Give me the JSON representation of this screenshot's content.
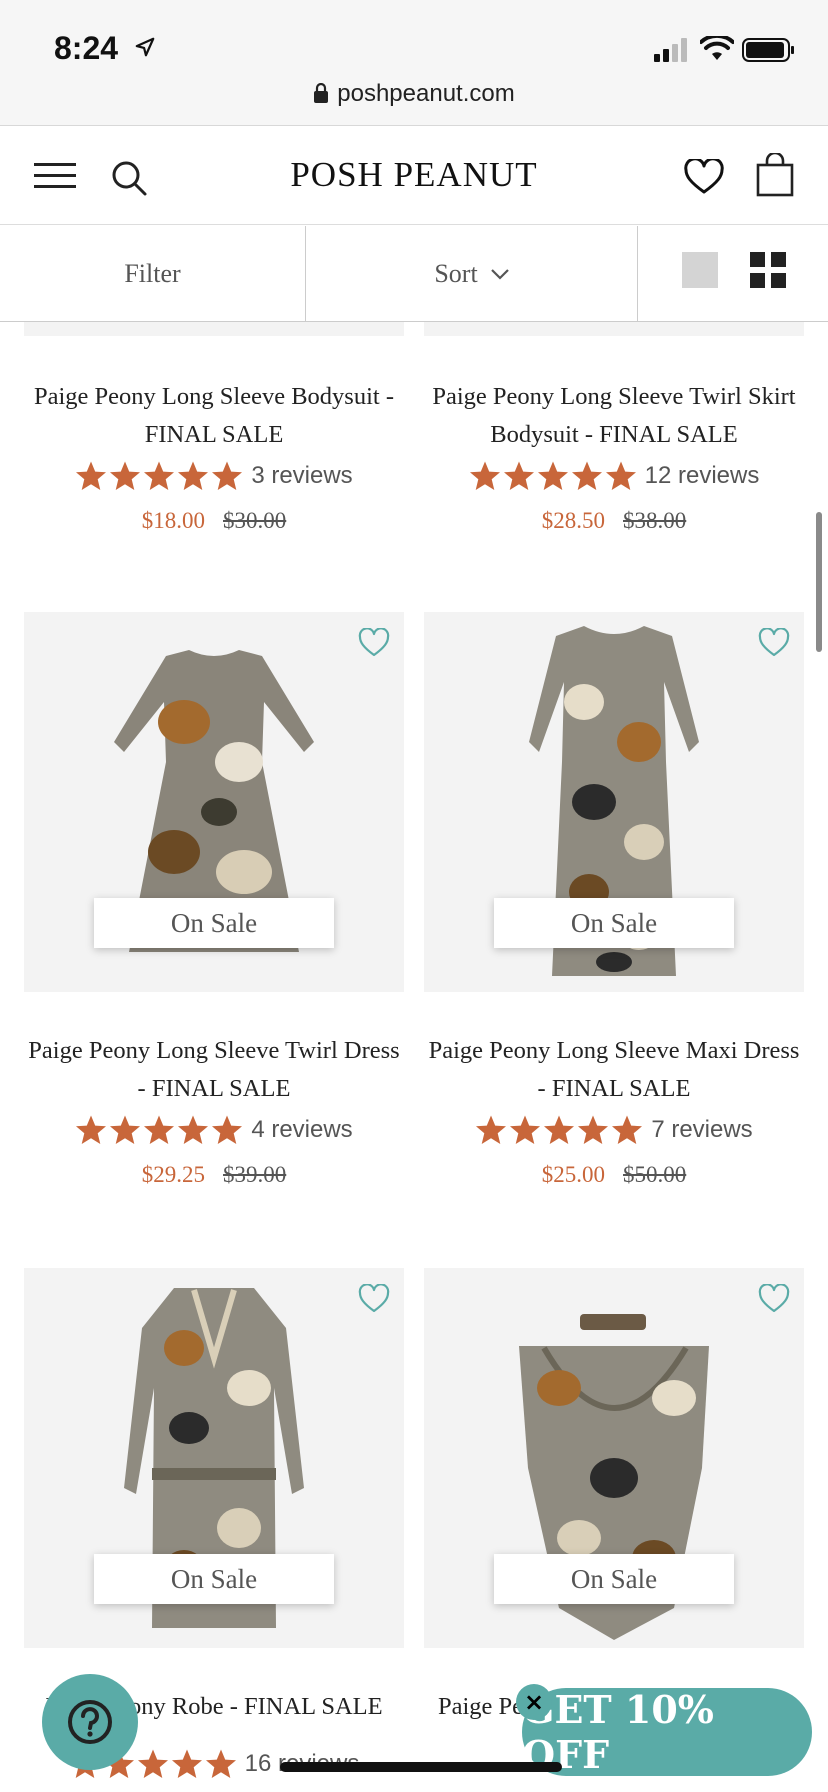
{
  "status_bar": {
    "time": "8:24",
    "url": "poshpeanut.com"
  },
  "header": {
    "brand": "POSH PEANUT"
  },
  "toolbar": {
    "filter_label": "Filter",
    "sort_label": "Sort"
  },
  "colors": {
    "accent": "#c8663a",
    "teal": "#5aaba7",
    "card_bg": "#f3f3f3"
  },
  "products": [
    {
      "title": "Paige Peony Long Sleeve Bodysuit - FINAL SALE",
      "rating": 5,
      "reviews": "3 reviews",
      "sale_price": "$18.00",
      "orig_price": "$30.00"
    },
    {
      "title": "Paige Peony Long Sleeve Twirl Skirt Bodysuit - FINAL SALE",
      "rating": 5,
      "reviews": "12 reviews",
      "sale_price": "$28.50",
      "orig_price": "$38.00"
    },
    {
      "title": "Paige Peony Long Sleeve Twirl Dress - FINAL SALE",
      "badge": "On Sale",
      "rating": 5,
      "reviews": "4 reviews",
      "sale_price": "$29.25",
      "orig_price": "$39.00"
    },
    {
      "title": "Paige Peony Long Sleeve Maxi Dress - FINAL SALE",
      "badge": "On Sale",
      "rating": 5,
      "reviews": "7 reviews",
      "sale_price": "$25.00",
      "orig_price": "$50.00"
    },
    {
      "title": "P",
      "title_tail": "ony Robe - FINAL SALE",
      "badge": "On Sale",
      "rating": 5,
      "reviews": "16 reviews"
    },
    {
      "title": "Paige Pe",
      "badge": "On Sale",
      "rating": 5
    }
  ],
  "promo": {
    "label": "GET 10% OFF",
    "close": "×"
  },
  "chat": {
    "icon": "help-icon"
  }
}
